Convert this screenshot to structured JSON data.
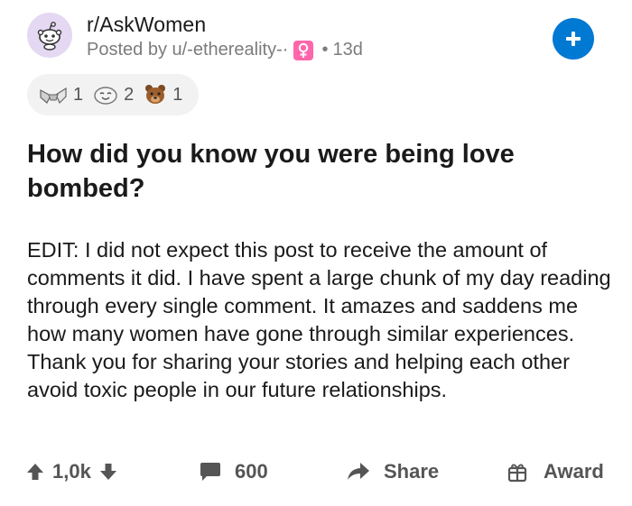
{
  "post": {
    "subreddit": "r/AskWomen",
    "posted_by": "Posted by u/-ethereality-·",
    "age": "13d",
    "awards": [
      {
        "icon": "silver-hands-award-icon",
        "count": "1"
      },
      {
        "icon": "wholesome-face-award-icon",
        "count": "2"
      },
      {
        "icon": "bear-award-icon",
        "count": "1"
      }
    ],
    "title": "How did you know you were being love bombed?",
    "body": "EDIT: I did not expect this post to receive the amount of comments it did. I have spent a large chunk of my day reading through every single comment. It amazes and saddens me how many women have gone through similar experiences. Thank you for sharing your stories and helping each other avoid toxic people in our future relationships."
  },
  "actions": {
    "score": "1,0k",
    "comments": "600",
    "share": "Share",
    "award": "Award"
  },
  "colors": {
    "join_button": "#0079d3",
    "avatar_bg": "#e4d8f2",
    "flair_pink": "#ff66ac",
    "muted_text": "#7c7c7c"
  }
}
